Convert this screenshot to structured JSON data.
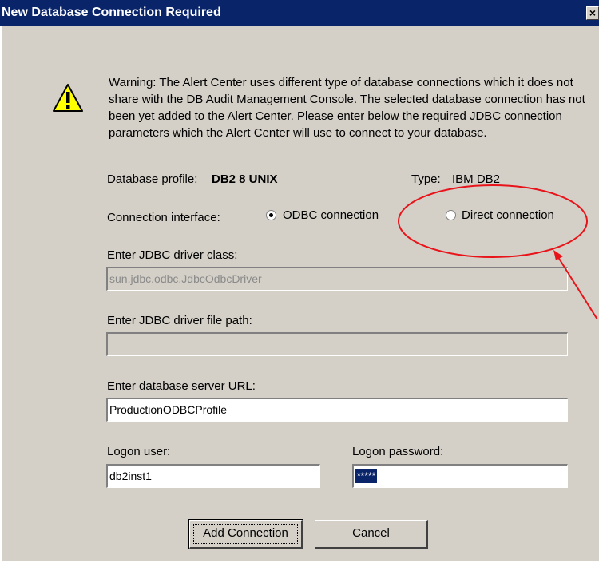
{
  "window": {
    "title": "New Database Connection Required",
    "close_glyph": "×"
  },
  "warning": {
    "icon": "warning-icon",
    "text": "Warning: The Alert Center uses different type of database connections which it does not share with the DB Audit Management Console.  The selected database connection has not been yet added to the Alert Center.  Please enter below the required JDBC connection parameters which the Alert Center will use to connect to your database."
  },
  "profile": {
    "label": "Database profile:",
    "value": "DB2 8 UNIX",
    "type_label": "Type:",
    "type_value": "IBM DB2"
  },
  "connection_interface": {
    "label": "Connection interface:",
    "options": [
      {
        "label": "ODBC connection",
        "checked": true
      },
      {
        "label": "Direct connection",
        "checked": false
      }
    ]
  },
  "driver_class": {
    "label": "Enter JDBC driver class:",
    "value": "sun.jdbc.odbc.JdbcOdbcDriver",
    "enabled": false
  },
  "driver_path": {
    "label": "Enter JDBC driver file path:",
    "value": "",
    "enabled": false
  },
  "server_url": {
    "label": "Enter database server URL:",
    "value": "ProductionODBCProfile"
  },
  "logon_user": {
    "label": "Logon user:",
    "value": "db2inst1"
  },
  "logon_password": {
    "label": "Logon password:",
    "value": "*****"
  },
  "buttons": {
    "add": "Add Connection",
    "cancel": "Cancel"
  },
  "colors": {
    "titlebar": "#0a246a",
    "dialog_bg": "#d4d0c8",
    "annotation": "#e8141a"
  }
}
